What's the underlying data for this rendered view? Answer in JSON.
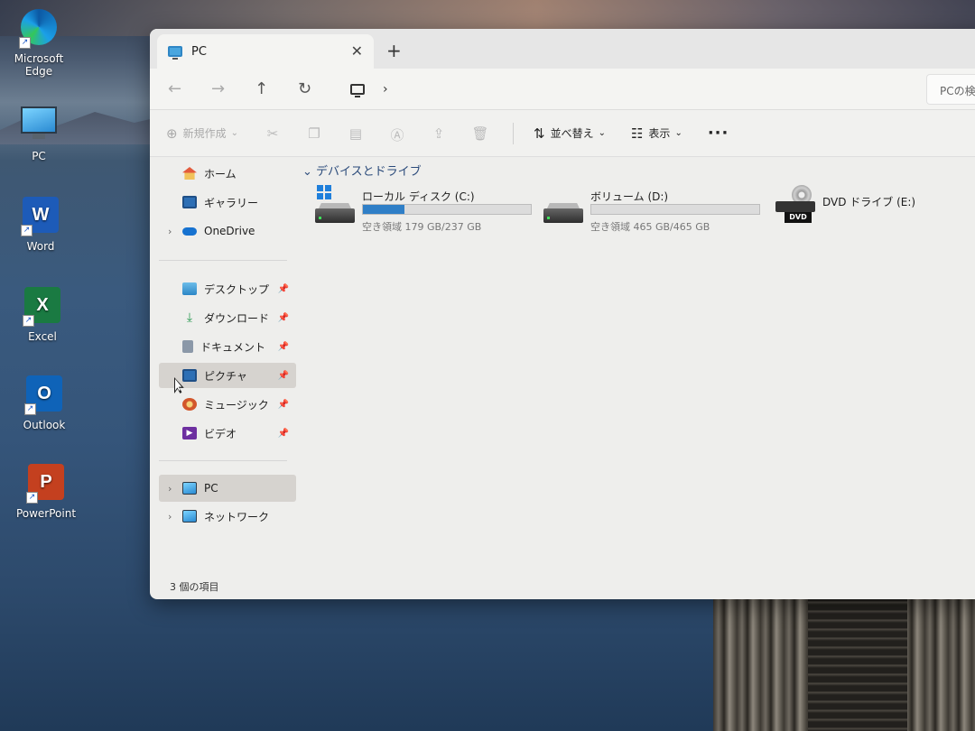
{
  "desktop": {
    "icons": [
      {
        "label": "Microsoft Edge",
        "icon": "edge-icon"
      },
      {
        "label": "PC",
        "icon": "pc-icon"
      },
      {
        "label": "Word",
        "icon": "word-icon"
      },
      {
        "label": "Excel",
        "icon": "excel-icon"
      },
      {
        "label": "Outlook",
        "icon": "outlook-icon"
      },
      {
        "label": "PowerPoint",
        "icon": "powerpoint-icon"
      }
    ]
  },
  "window": {
    "tab_title": "PC",
    "tab_close": "✕",
    "new_tab": "+",
    "nav": {
      "back": "←",
      "forward": "→",
      "up": "↑",
      "refresh": "↻",
      "chevron": "›"
    },
    "search_placeholder": "PCの検",
    "cmdbar": {
      "new_label": "新規作成",
      "sort_label": "並べ替え",
      "view_label": "表示",
      "more_label": "···"
    },
    "sidebar": {
      "top": [
        {
          "label": "ホーム",
          "icon": "home-icon"
        },
        {
          "label": "ギャラリー",
          "icon": "gallery-icon"
        },
        {
          "label": "OneDrive",
          "icon": "onedrive-icon"
        }
      ],
      "quick": [
        {
          "label": "デスクトップ",
          "icon": "desktop-folder-icon"
        },
        {
          "label": "ダウンロード",
          "icon": "download-icon"
        },
        {
          "label": "ドキュメント",
          "icon": "document-icon"
        },
        {
          "label": "ピクチャ",
          "icon": "pictures-icon"
        },
        {
          "label": "ミュージック",
          "icon": "music-icon"
        },
        {
          "label": "ビデオ",
          "icon": "video-icon"
        }
      ],
      "bottom": [
        {
          "label": "PC",
          "icon": "pc-icon"
        },
        {
          "label": "ネットワーク",
          "icon": "network-icon"
        }
      ]
    },
    "group_header": "デバイスとドライブ",
    "drives": [
      {
        "name": "ローカル ディスク (C:)",
        "free_text": "空き領域 179 GB/237 GB",
        "used_fraction": 0.245
      },
      {
        "name": "ボリューム (D:)",
        "free_text": "空き領域 465 GB/465 GB",
        "used_fraction": 0.0
      },
      {
        "name": "DVD ドライブ (E:)",
        "badge": "DVD"
      }
    ],
    "status": "3 個の項目"
  }
}
